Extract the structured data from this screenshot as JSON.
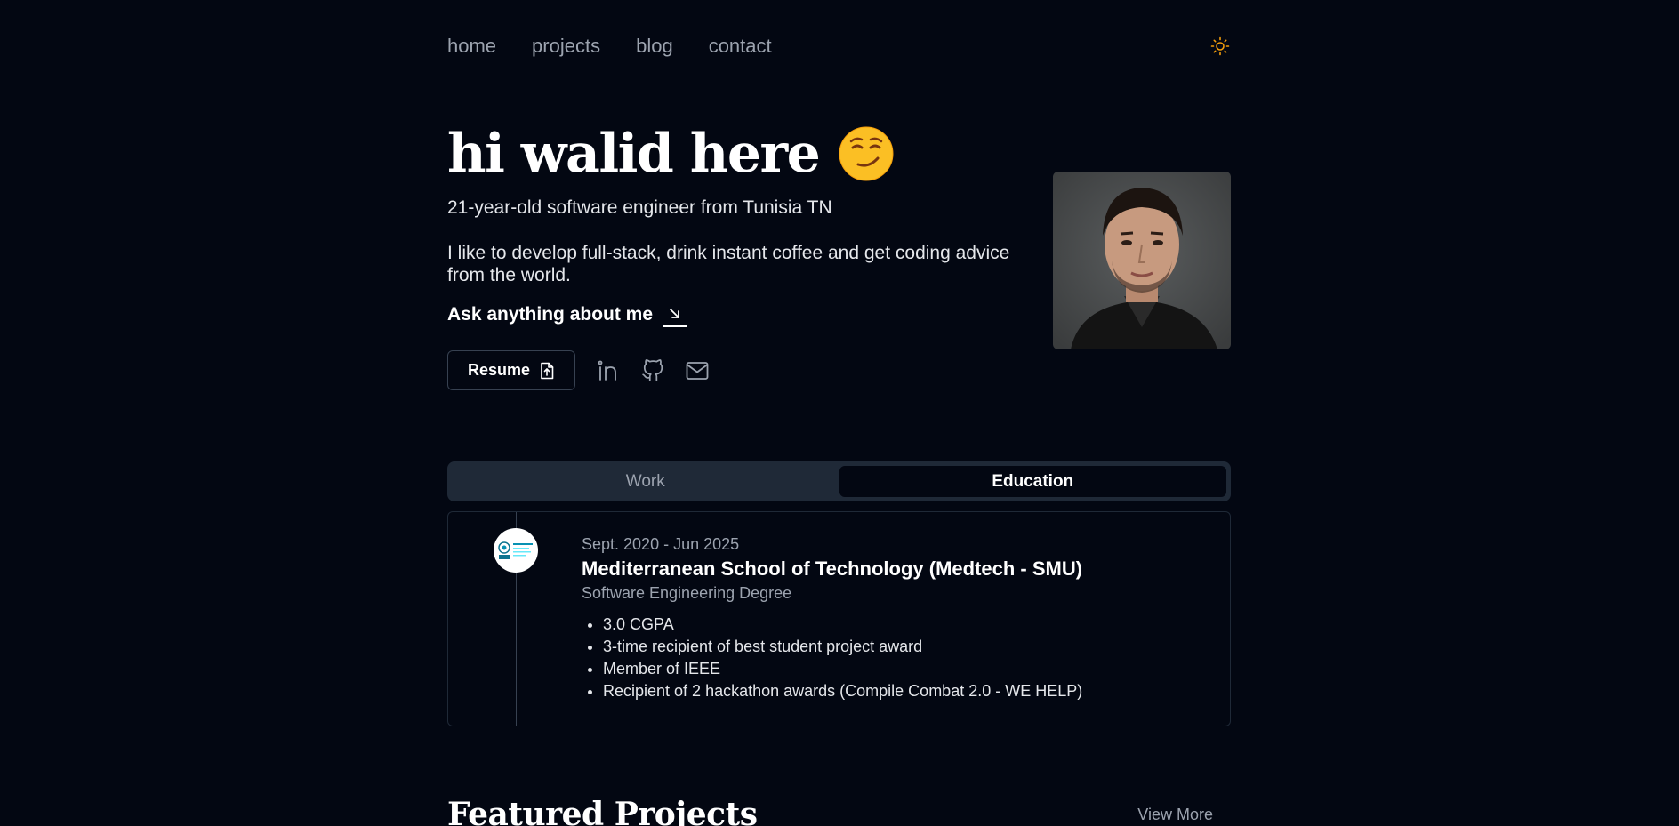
{
  "nav": {
    "items": [
      {
        "label": "home"
      },
      {
        "label": "projects"
      },
      {
        "label": "blog"
      },
      {
        "label": "contact"
      }
    ],
    "theme_icon": "sun-icon"
  },
  "hero": {
    "title": "hi walid here",
    "emoji_icon": "smirking-face-emoji",
    "subtitle": "21-year-old software engineer from Tunisia TN",
    "bio": "I like to develop full-stack, drink instant coffee and get coding advice from the world.",
    "ask_label": "Ask anything about me",
    "ask_icon": "arrow-down-right-icon",
    "resume_label": "Resume",
    "resume_icon": "file-download-icon",
    "socials": [
      {
        "icon": "linkedin-icon"
      },
      {
        "icon": "github-icon"
      },
      {
        "icon": "mail-icon"
      }
    ]
  },
  "tabs": [
    {
      "label": "Work",
      "active": false
    },
    {
      "label": "Education",
      "active": true
    }
  ],
  "education": {
    "date": "Sept. 2020 - Jun 2025",
    "school": "Mediterranean School of Technology (Medtech - SMU)",
    "degree": "Software Engineering Degree",
    "bullets": [
      "3.0 CGPA",
      "3-time recipient of best student project award",
      "Member of IEEE",
      "Recipient of 2 hackathon awards (Compile Combat 2.0 - WE HELP)"
    ]
  },
  "featured": {
    "title": "Featured Projects",
    "view_more": "View More"
  },
  "colors": {
    "background": "#030712",
    "accent_sun": "#f59e0b",
    "muted": "#9ca3af"
  }
}
